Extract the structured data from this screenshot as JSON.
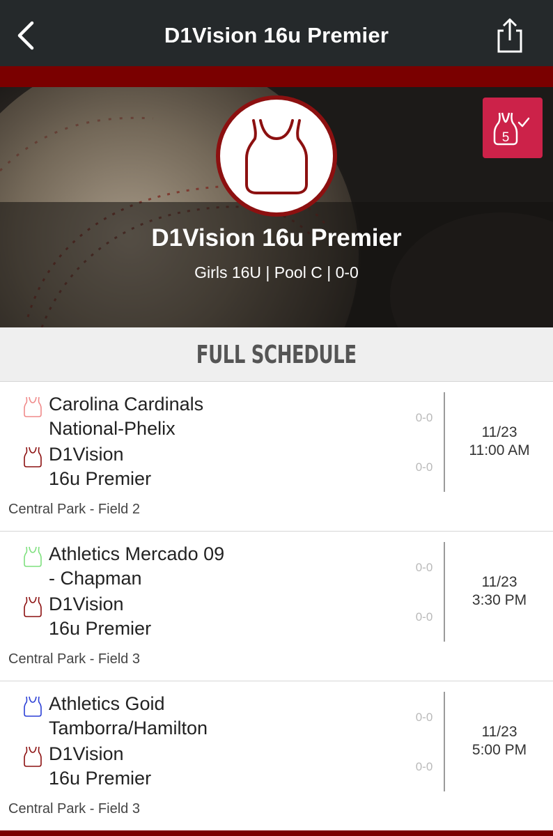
{
  "nav": {
    "title": "D1Vision 16u Premier",
    "back_icon": "chevron-left-icon",
    "share_icon": "share-icon"
  },
  "hero": {
    "team_name": "D1Vision 16u Premier",
    "subtitle": "Girls 16U | Pool C | 0-0",
    "logo_icon": "jersey-icon",
    "follow_icon": "jersey-five-check-icon",
    "follow_number": "5",
    "colors": {
      "accent_red": "#7a0000",
      "logo_border": "#8c1010",
      "follow_btn": "#cc2249"
    }
  },
  "schedule": {
    "header": "FULL SCHEDULE",
    "games": [
      {
        "team1_line1": "Carolina Cardinals",
        "team1_line2": "National-Phelix",
        "team1_color": "#f08a8a",
        "team2_line1": "D1Vision",
        "team2_line2": "16u Premier",
        "team2_color": "#8c1010",
        "score1": "0-0",
        "score2": "0-0",
        "date": "11/23",
        "time": "11:00 AM",
        "location": "Central Park - Field 2"
      },
      {
        "team1_line1": "Athletics Mercado 09",
        "team1_line2": "- Chapman",
        "team1_color": "#7ee07e",
        "team2_line1": "D1Vision",
        "team2_line2": "16u Premier",
        "team2_color": "#8c1010",
        "score1": "0-0",
        "score2": "0-0",
        "date": "11/23",
        "time": "3:30 PM",
        "location": "Central Park - Field 3"
      },
      {
        "team1_line1": "Athletics Goid",
        "team1_line2": "Tamborra/Hamilton",
        "team1_color": "#2b3fd6",
        "team2_line1": "D1Vision",
        "team2_line2": "16u Premier",
        "team2_color": "#8c1010",
        "score1": "0-0",
        "score2": "0-0",
        "date": "11/23",
        "time": "5:00 PM",
        "location": "Central Park - Field 3"
      }
    ]
  }
}
